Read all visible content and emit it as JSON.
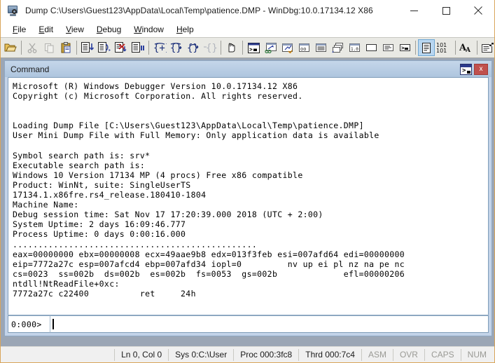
{
  "window": {
    "title": "Dump C:\\Users\\Guest123\\AppData\\Local\\Temp\\patience.DMP - WinDbg:10.0.17134.12 X86",
    "icon": "windbg-app-icon",
    "minimize_label": "Minimize",
    "maximize_label": "Maximize",
    "close_label": "Close"
  },
  "menubar": {
    "items": [
      {
        "label": "File",
        "accel": "F",
        "name": "menu-file"
      },
      {
        "label": "Edit",
        "accel": "E",
        "name": "menu-edit"
      },
      {
        "label": "View",
        "accel": "V",
        "name": "menu-view"
      },
      {
        "label": "Debug",
        "accel": "D",
        "name": "menu-debug"
      },
      {
        "label": "Window",
        "accel": "W",
        "name": "menu-window"
      },
      {
        "label": "Help",
        "accel": "H",
        "name": "menu-help"
      }
    ]
  },
  "toolbar": {
    "buttons": [
      {
        "name": "open-file-icon",
        "tip": "Open Source File"
      },
      {
        "sep": true
      },
      {
        "name": "cut-icon",
        "tip": "Cut",
        "disabled": true
      },
      {
        "name": "copy-icon",
        "tip": "Copy",
        "disabled": true
      },
      {
        "name": "paste-icon",
        "tip": "Paste"
      },
      {
        "sep": true
      },
      {
        "name": "step-into-source-icon",
        "tip": "Step Into Source Line"
      },
      {
        "name": "step-over-source-icon",
        "tip": "Step Over Source Line"
      },
      {
        "name": "run-to-cursor-icon",
        "tip": "Run To Cursor"
      },
      {
        "name": "break-icon",
        "tip": "Break"
      },
      {
        "sep": true
      },
      {
        "name": "step-into-icon",
        "tip": "Step Into"
      },
      {
        "name": "step-over-icon",
        "tip": "Step Over"
      },
      {
        "name": "step-out-icon",
        "tip": "Step Out"
      },
      {
        "name": "step-branch-icon",
        "tip": "Step To Next Branch",
        "disabled": true
      },
      {
        "sep": true
      },
      {
        "name": "hand-stop-icon",
        "tip": "Break"
      },
      {
        "sep": true
      },
      {
        "name": "command-window-icon",
        "tip": "Command"
      },
      {
        "name": "watch-window-icon",
        "tip": "Watch"
      },
      {
        "name": "locals-window-icon",
        "tip": "Locals"
      },
      {
        "name": "registers-window-icon",
        "tip": "Registers"
      },
      {
        "name": "memory-window-icon",
        "tip": "Memory"
      },
      {
        "name": "call-stack-icon",
        "tip": "Call Stack"
      },
      {
        "name": "disassembly-icon",
        "tip": "Disassembly"
      },
      {
        "name": "scratch-pad-icon",
        "tip": "Scratch Pad"
      },
      {
        "name": "processes-icon",
        "tip": "Processes and Threads"
      },
      {
        "name": "command-browser-icon",
        "tip": "Command Browser"
      },
      {
        "sep": true
      },
      {
        "name": "source-mode-icon",
        "tip": "Source Mode",
        "active": true
      },
      {
        "name": "numbers-101-icon",
        "tip": "Toggle Base"
      },
      {
        "sep": true
      },
      {
        "name": "font-icon",
        "tip": "Font"
      },
      {
        "sep": true
      },
      {
        "name": "options-icon",
        "tip": "Options"
      }
    ]
  },
  "command_window": {
    "title": "Command",
    "restore_icon": "restore-command-window-icon",
    "close_label": "x",
    "prompt": "0:000>",
    "input_value": "",
    "output": "Microsoft (R) Windows Debugger Version 10.0.17134.12 X86\nCopyright (c) Microsoft Corporation. All rights reserved.\n\n\nLoading Dump File [C:\\Users\\Guest123\\AppData\\Local\\Temp\\patience.DMP]\nUser Mini Dump File with Full Memory: Only application data is available\n\nSymbol search path is: srv*\nExecutable search path is:\nWindows 10 Version 17134 MP (4 procs) Free x86 compatible\nProduct: WinNt, suite: SingleUserTS\n17134.1.x86fre.rs4_release.180410-1804\nMachine Name:\nDebug session time: Sat Nov 17 17:20:39.000 2018 (UTC + 2:00)\nSystem Uptime: 2 days 16:09:46.777\nProcess Uptime: 0 days 0:00:16.000\n................................................\neax=00000000 ebx=00000008 ecx=49aae9b8 edx=013f3feb esi=007afd64 edi=00000000\neip=7772a27c esp=007afcd4 ebp=007afd34 iopl=0         nv up ei pl nz na pe nc\ncs=0023  ss=002b  ds=002b  es=002b  fs=0053  gs=002b             efl=00000206\nntdll!NtReadFile+0xc:\n7772a27c c22400          ret     24h"
  },
  "statusbar": {
    "cells": [
      {
        "label": "Ln 0, Col 0",
        "name": "status-line-col",
        "dim": false
      },
      {
        "label": "Sys 0:C:\\User",
        "name": "status-system",
        "dim": false
      },
      {
        "label": "Proc 000:3fc8",
        "name": "status-process",
        "dim": false
      },
      {
        "label": "Thrd 000:7c4",
        "name": "status-thread",
        "dim": false
      },
      {
        "label": "ASM",
        "name": "status-asm",
        "dim": true
      },
      {
        "label": "OVR",
        "name": "status-ovr",
        "dim": true
      },
      {
        "label": "CAPS",
        "name": "status-caps",
        "dim": true
      },
      {
        "label": "NUM",
        "name": "status-num",
        "dim": true
      }
    ]
  },
  "colors": {
    "mdi_background": "#9ba6b5",
    "cmd_title": "#b9cce2",
    "close_red": "#c0504d",
    "active_tool": "#b8d6f0",
    "window_border": "#d9a55a"
  }
}
